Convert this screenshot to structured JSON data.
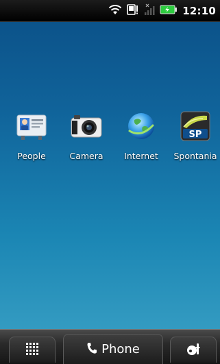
{
  "status_bar": {
    "time": "12:10",
    "icons": [
      "wifi-icon",
      "notification-icon",
      "signal-icon",
      "battery-charging-icon"
    ]
  },
  "apps": [
    {
      "label": "People",
      "icon": "people-icon"
    },
    {
      "label": "Camera",
      "icon": "camera-icon"
    },
    {
      "label": "Internet",
      "icon": "internet-globe-icon"
    },
    {
      "label": "Spontania",
      "icon": "spontania-icon",
      "logo_text": "SP"
    }
  ],
  "dock": {
    "all_apps_icon": "grid-icon",
    "phone_label": "Phone",
    "phone_icon": "phone-handset-icon",
    "personalize_icon": "personalize-icon"
  },
  "colors": {
    "wallpaper_top": "#0b4f86",
    "wallpaper_bottom": "#3da3c6",
    "battery": "#2ecc40"
  }
}
